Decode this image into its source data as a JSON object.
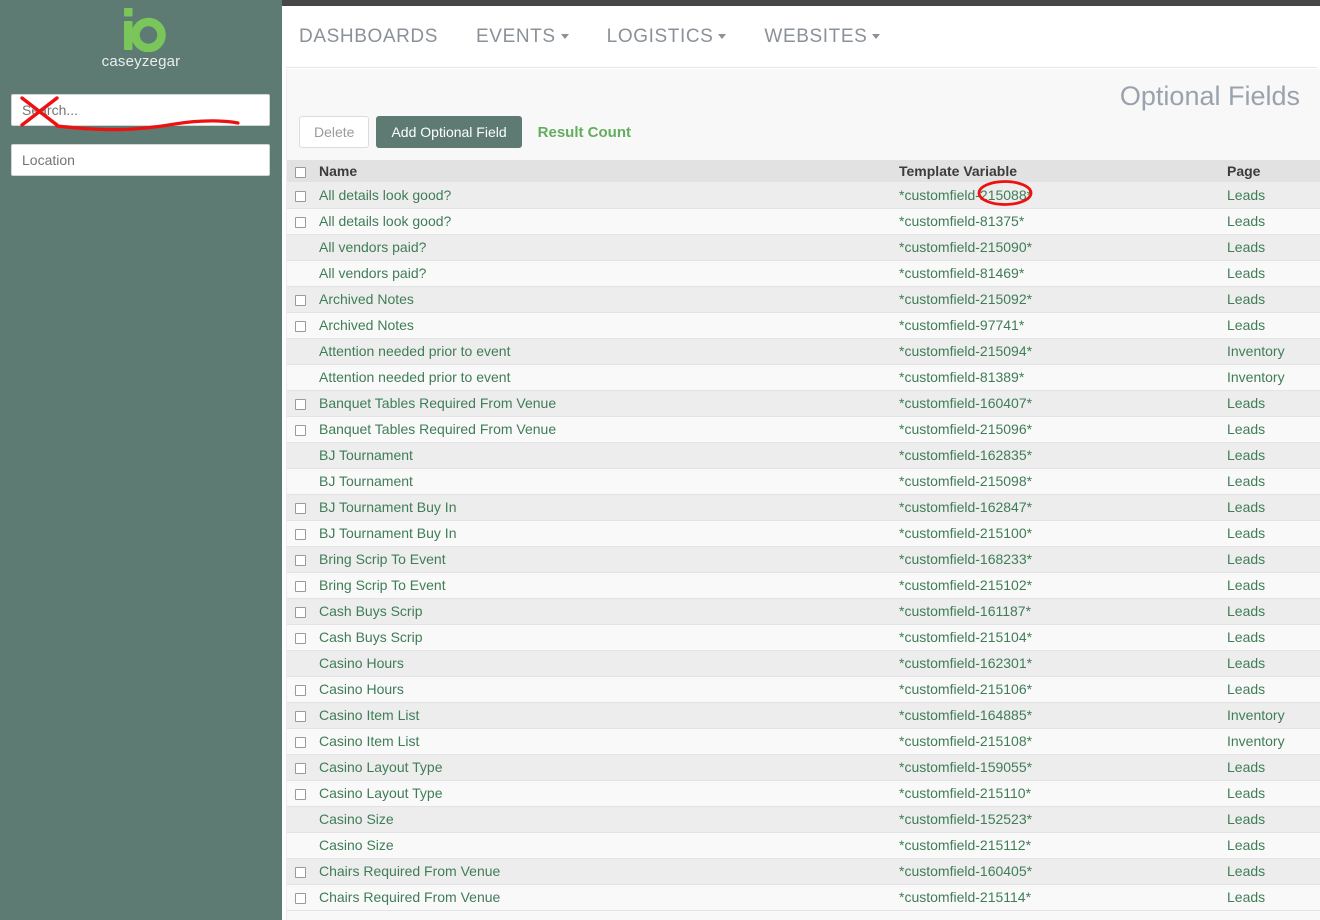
{
  "sidebar": {
    "logo_icon": "io-logo-icon",
    "logo_color": "#7ac65b",
    "brand_name": "caseyzegar",
    "search_placeholder": "Search...",
    "search_value": "",
    "location_placeholder": "Location",
    "location_value": "",
    "background_color": "#5d7a73"
  },
  "nav": {
    "items": [
      {
        "label": "DASHBOARDS",
        "has_caret": false
      },
      {
        "label": "EVENTS",
        "has_caret": true
      },
      {
        "label": "LOGISTICS",
        "has_caret": true
      },
      {
        "label": "WEBSITES",
        "has_caret": true
      }
    ]
  },
  "main": {
    "title": "Optional Fields",
    "toolbar": {
      "delete_label": "Delete",
      "add_label": "Add Optional Field",
      "result_count_label": "Result Count",
      "accent_color": "#5d7a73",
      "link_color": "#63ae5e"
    },
    "table": {
      "columns": [
        "",
        "Name",
        "Template Variable",
        "Page"
      ],
      "select_all_checkbox": true,
      "rows": [
        {
          "checkbox": true,
          "name": "All details look good?",
          "variable": "*customfield-215088*",
          "page": "Leads"
        },
        {
          "checkbox": true,
          "name": "All details look good?",
          "variable": "*customfield-81375*",
          "page": "Leads"
        },
        {
          "checkbox": false,
          "name": "All vendors paid?",
          "variable": "*customfield-215090*",
          "page": "Leads"
        },
        {
          "checkbox": false,
          "name": "All vendors paid?",
          "variable": "*customfield-81469*",
          "page": "Leads"
        },
        {
          "checkbox": true,
          "name": "Archived Notes",
          "variable": "*customfield-215092*",
          "page": "Leads"
        },
        {
          "checkbox": true,
          "name": "Archived Notes",
          "variable": "*customfield-97741*",
          "page": "Leads"
        },
        {
          "checkbox": false,
          "name": "Attention needed prior to event",
          "variable": "*customfield-215094*",
          "page": "Inventory"
        },
        {
          "checkbox": false,
          "name": "Attention needed prior to event",
          "variable": "*customfield-81389*",
          "page": "Inventory"
        },
        {
          "checkbox": true,
          "name": "Banquet Tables Required From Venue",
          "variable": "*customfield-160407*",
          "page": "Leads"
        },
        {
          "checkbox": true,
          "name": "Banquet Tables Required From Venue",
          "variable": "*customfield-215096*",
          "page": "Leads"
        },
        {
          "checkbox": false,
          "name": "BJ Tournament",
          "variable": "*customfield-162835*",
          "page": "Leads"
        },
        {
          "checkbox": false,
          "name": "BJ Tournament",
          "variable": "*customfield-215098*",
          "page": "Leads"
        },
        {
          "checkbox": true,
          "name": "BJ Tournament Buy In",
          "variable": "*customfield-162847*",
          "page": "Leads"
        },
        {
          "checkbox": true,
          "name": "BJ Tournament Buy In",
          "variable": "*customfield-215100*",
          "page": "Leads"
        },
        {
          "checkbox": true,
          "name": "Bring Scrip To Event",
          "variable": "*customfield-168233*",
          "page": "Leads"
        },
        {
          "checkbox": true,
          "name": "Bring Scrip To Event",
          "variable": "*customfield-215102*",
          "page": "Leads"
        },
        {
          "checkbox": true,
          "name": "Cash Buys Scrip",
          "variable": "*customfield-161187*",
          "page": "Leads"
        },
        {
          "checkbox": true,
          "name": "Cash Buys Scrip",
          "variable": "*customfield-215104*",
          "page": "Leads"
        },
        {
          "checkbox": false,
          "name": "Casino Hours",
          "variable": "*customfield-162301*",
          "page": "Leads"
        },
        {
          "checkbox": true,
          "name": "Casino Hours",
          "variable": "*customfield-215106*",
          "page": "Leads"
        },
        {
          "checkbox": true,
          "name": "Casino Item List",
          "variable": "*customfield-164885*",
          "page": "Inventory"
        },
        {
          "checkbox": true,
          "name": "Casino Item List",
          "variable": "*customfield-215108*",
          "page": "Inventory"
        },
        {
          "checkbox": true,
          "name": "Casino Layout Type",
          "variable": "*customfield-159055*",
          "page": "Leads"
        },
        {
          "checkbox": true,
          "name": "Casino Layout Type",
          "variable": "*customfield-215110*",
          "page": "Leads"
        },
        {
          "checkbox": false,
          "name": "Casino Size",
          "variable": "*customfield-152523*",
          "page": "Leads"
        },
        {
          "checkbox": false,
          "name": "Casino Size",
          "variable": "*customfield-215112*",
          "page": "Leads"
        },
        {
          "checkbox": true,
          "name": "Chairs Required From Venue",
          "variable": "*customfield-160405*",
          "page": "Leads"
        },
        {
          "checkbox": true,
          "name": "Chairs Required From Venue",
          "variable": "*customfield-215114*",
          "page": "Leads"
        }
      ]
    }
  },
  "annotations": {
    "color": "#ee1111",
    "search_cross_out": "red-x-over-search-field",
    "search_underline": "red-underline-under-search-field",
    "circled_value": "215088",
    "circle_target": "red-ellipse-around-customfield-id"
  }
}
